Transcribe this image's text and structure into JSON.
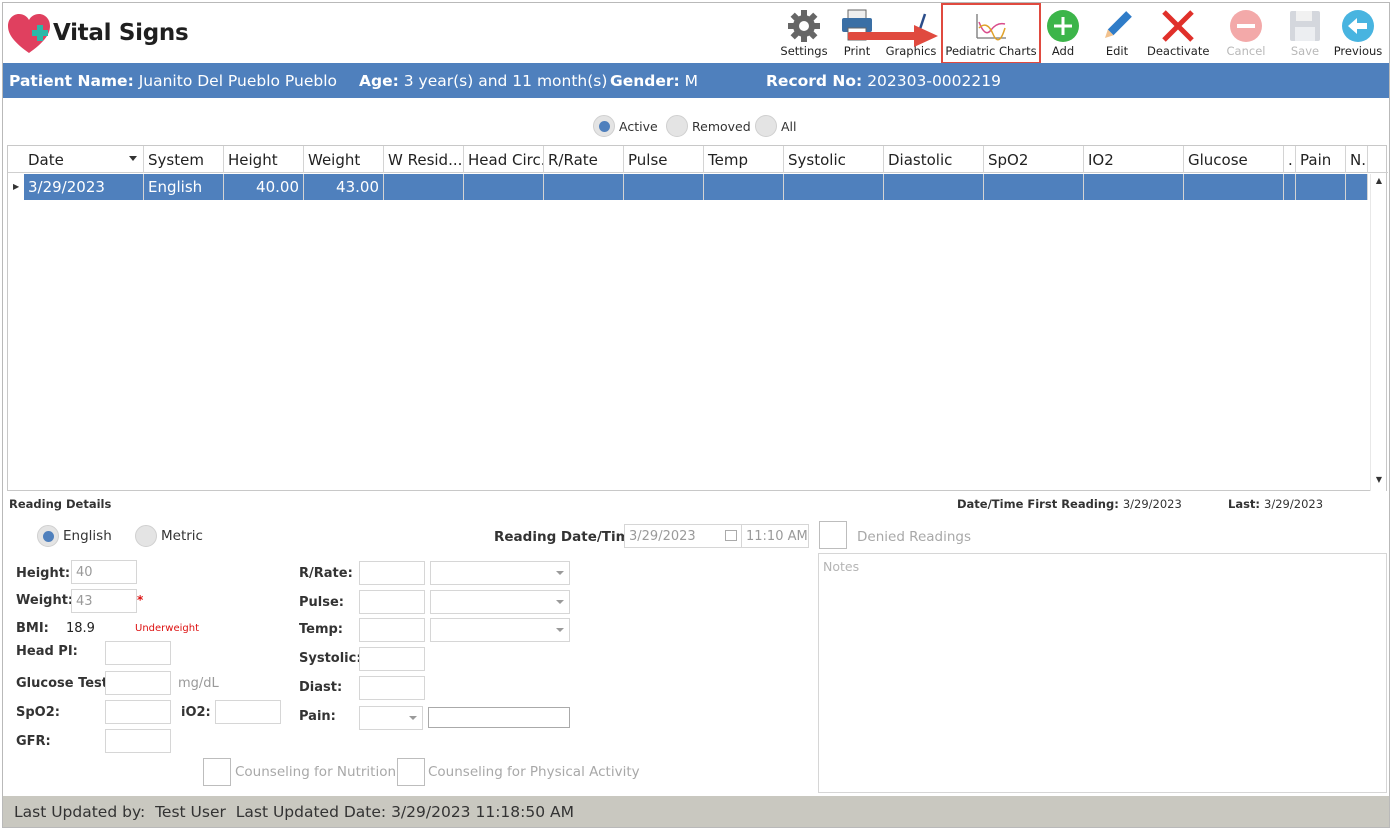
{
  "app": {
    "title": "Vital Signs"
  },
  "toolbar": {
    "settings": "Settings",
    "print": "Print",
    "graphics": "Graphics",
    "pediatric_charts": "Pediatric Charts",
    "add": "Add",
    "edit": "Edit",
    "deactivate": "Deactivate",
    "cancel": "Cancel",
    "save": "Save",
    "previous": "Previous"
  },
  "patient": {
    "name_label": "Patient Name:",
    "name": "Juanito Del Pueblo Pueblo",
    "age_label": "Age:",
    "age": "3 year(s) and 11 month(s)",
    "gender_label": "Gender:",
    "gender": "M",
    "record_label": "Record No:",
    "record": "202303-0002219"
  },
  "filter": {
    "options": [
      "Active",
      "Removed",
      "All"
    ],
    "selected": "Active"
  },
  "grid": {
    "columns": [
      "Date",
      "System",
      "Height",
      "Weight",
      "W Resid...",
      "Head Circ.",
      "R/Rate",
      "Pulse",
      "Temp",
      "Systolic",
      "Diastolic",
      "SpO2",
      "IO2",
      "Glucose",
      ".",
      "Pain",
      "N."
    ],
    "rows": [
      [
        "3/29/2023",
        "English",
        "40.00",
        "43.00",
        "",
        "",
        "",
        "",
        "",
        "",
        "",
        "",
        "",
        "",
        "",
        "",
        ""
      ]
    ]
  },
  "details": {
    "section_title": "Reading Details",
    "first_reading_label": "Date/Time First Reading:",
    "first_reading": "3/29/2023",
    "last_label": "Last:",
    "last": "3/29/2023",
    "system_options": [
      "English",
      "Metric"
    ],
    "system_selected": "English",
    "reading_dt_label": "Reading Date/Time:",
    "reading_date": "3/29/2023",
    "reading_time": "11:10 AM",
    "denied_label": "Denied Readings",
    "notes_placeholder": "Notes",
    "height_label": "Height:",
    "height": "40",
    "weight_label": "Weight:",
    "weight": "43",
    "weight_required": "*",
    "bmi_label": "BMI:",
    "bmi": "18.9",
    "bmi_status": "Underweight",
    "headpi_label": "Head PI:",
    "glucose_label": "Glucose Test:",
    "glucose_unit": "mg/dL",
    "spo2_label": "SpO2:",
    "io2_label": "iO2:",
    "gfr_label": "GFR:",
    "rrate_label": "R/Rate:",
    "pulse_label": "Pulse:",
    "temp_label": "Temp:",
    "systolic_label": "Systolic:",
    "diast_label": "Diast:",
    "pain_label": "Pain:",
    "counsel_nutrition": "Counseling for Nutrition",
    "counsel_activity": "Counseling for Physical Activity"
  },
  "status": {
    "updated_by_label": "Last Updated by:",
    "updated_by": "Test User",
    "updated_date_label": "Last Updated Date:",
    "updated_date": "3/29/2023 11:18:50 AM"
  },
  "colors": {
    "accent": "#4f80bd",
    "highlight": "#e04a3f",
    "status_bar": "#c9c8c0"
  }
}
